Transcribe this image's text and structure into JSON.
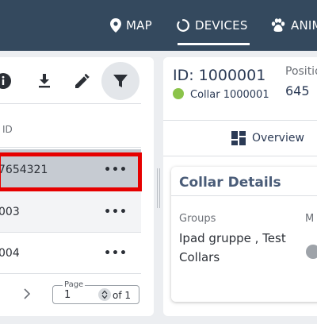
{
  "nav": {
    "items": [
      {
        "label": "MAP",
        "icon": "map-pin-icon"
      },
      {
        "label": "DEVICES",
        "icon": "circle-arc-icon"
      },
      {
        "label": "ANIM",
        "icon": "paw-icon"
      }
    ],
    "active": "DEVICES"
  },
  "toolbar": {
    "icons": [
      "info-icon",
      "download-icon",
      "edit-icon",
      "filter-icon"
    ]
  },
  "table": {
    "column_header": "ID",
    "rows": [
      {
        "id": "7654321",
        "selected": true
      },
      {
        "id": "003",
        "selected": false
      },
      {
        "id": "004",
        "selected": false
      }
    ]
  },
  "pager": {
    "legend": "Page",
    "value": "1",
    "of": "of 1"
  },
  "detail": {
    "id": "ID: 1000001",
    "collar": "Collar 1000001",
    "position_label": "Positio",
    "position_value": "645",
    "tab_overview": "Overview",
    "card_title": "Collar Details",
    "groups_label": "Groups",
    "groups_value": "Ipad gruppe , Test Collars",
    "m_label": "M"
  },
  "colors": {
    "nav_bg": "#34495e",
    "selected_row": "#c6cbd2",
    "highlight_outline": "#e60000",
    "status_green": "#8bc34a",
    "title_blue": "#4a5c78"
  }
}
